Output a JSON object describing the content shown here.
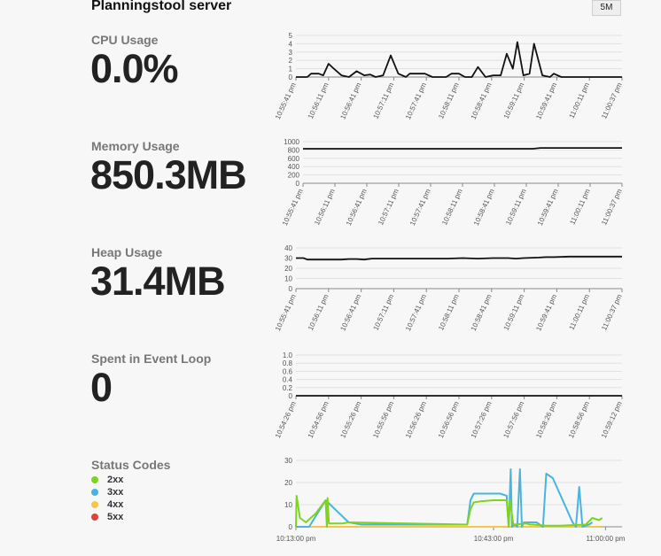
{
  "header": {
    "title": "Planningstool server",
    "range_button": "5M"
  },
  "metrics": {
    "cpu": {
      "label": "CPU Usage",
      "value": "0.0%"
    },
    "memory": {
      "label": "Memory Usage",
      "value": "850.3MB"
    },
    "heap": {
      "label": "Heap Usage",
      "value": "31.4MB"
    },
    "event_loop": {
      "label": "Spent in Event Loop",
      "value": "0"
    },
    "status": {
      "label": "Status Codes"
    }
  },
  "legend": [
    {
      "label": "2xx",
      "color": "#7ed321"
    },
    {
      "label": "3xx",
      "color": "#4ab4de"
    },
    {
      "label": "4xx",
      "color": "#f5c748"
    },
    {
      "label": "5xx",
      "color": "#d9453b"
    }
  ],
  "chart_data": [
    {
      "id": "cpu",
      "type": "line",
      "ylim": [
        0,
        5
      ],
      "yticks": [
        "0",
        "1",
        "2",
        "3",
        "4",
        "5"
      ],
      "xticks": [
        "10:55:41 pm",
        "10:56:11 pm",
        "10:56:41 pm",
        "10:57:11 pm",
        "10:57:41 pm",
        "10:58:11 pm",
        "10:58:41 pm",
        "10:59:11 pm",
        "10:59:41 pm",
        "11:00:11 pm",
        "11:00:37 pm"
      ],
      "series": [
        {
          "color": "#111111",
          "x": [
            0,
            1.5,
            2,
            3,
            3.6,
            4.3,
            5,
            6,
            7,
            8,
            9,
            9.8,
            10.5,
            11.5,
            12.5,
            13.5,
            14.5,
            15,
            16,
            17,
            18,
            19,
            19.8,
            20.5,
            21.5,
            22.3,
            23.2,
            24,
            25,
            26,
            27,
            27.8,
            28.6,
            29.2,
            30,
            30.8,
            31.4,
            32.5,
            33.5,
            34,
            35,
            36,
            37,
            38,
            39,
            40,
            41,
            42,
            43
          ],
          "y": [
            0,
            0,
            0.4,
            0.4,
            0.2,
            1.6,
            1.0,
            0.2,
            0,
            0.7,
            0.2,
            0.3,
            0,
            0.2,
            2.6,
            0.4,
            0,
            0.4,
            0.4,
            0.4,
            0,
            0,
            0,
            0.4,
            0.4,
            0,
            0,
            1.2,
            0,
            0.2,
            0.2,
            2.8,
            1.0,
            4.2,
            0.2,
            0.4,
            4.0,
            0.2,
            0,
            0.4,
            0,
            0,
            0,
            0,
            0,
            0,
            0,
            0,
            0
          ]
        }
      ]
    },
    {
      "id": "memory",
      "type": "line",
      "ylim": [
        0,
        1000
      ],
      "yticks": [
        "0",
        "200",
        "400",
        "600",
        "800",
        "1000"
      ],
      "xticks": [
        "10:55:41 pm",
        "10:56:11 pm",
        "10:56:41 pm",
        "10:57:11 pm",
        "10:57:41 pm",
        "10:58:11 pm",
        "10:58:41 pm",
        "10:59:11 pm",
        "10:59:41 pm",
        "11:00:11 pm",
        "11:00:37 pm"
      ],
      "series": [
        {
          "color": "#111111",
          "x": [
            0,
            10,
            20,
            30,
            31,
            32,
            40,
            43
          ],
          "y": [
            830,
            830,
            830,
            830,
            830,
            850,
            850,
            850
          ]
        }
      ]
    },
    {
      "id": "heap",
      "type": "line",
      "ylim": [
        0,
        40
      ],
      "yticks": [
        "0",
        "10",
        "20",
        "30",
        "40"
      ],
      "xticks": [
        "10:55:41 pm",
        "10:56:11 pm",
        "10:56:41 pm",
        "10:57:11 pm",
        "10:57:41 pm",
        "10:58:11 pm",
        "10:58:41 pm",
        "10:59:11 pm",
        "10:59:41 pm",
        "11:00:11 pm",
        "11:00:37 pm"
      ],
      "series": [
        {
          "color": "#111111",
          "x": [
            0,
            1,
            1.5,
            3,
            6,
            7,
            8,
            9,
            10,
            12,
            14,
            16,
            18,
            20,
            22,
            24,
            26,
            28,
            29,
            30,
            32,
            33,
            34,
            36,
            38,
            40,
            43
          ],
          "y": [
            30,
            30,
            28.5,
            28.5,
            28.5,
            29,
            29,
            28.5,
            29.5,
            29.5,
            29.5,
            29.5,
            29.5,
            29.5,
            30,
            29.5,
            30,
            30,
            29.5,
            30,
            30.5,
            31,
            31,
            31.5,
            31.5,
            31.5,
            31.5
          ]
        }
      ]
    },
    {
      "id": "event_loop",
      "type": "line",
      "ylim": [
        0,
        1.0
      ],
      "yticks": [
        "0",
        "0.2",
        "0.4",
        "0.6",
        "0.8",
        "1.0"
      ],
      "xticks": [
        "10:54:26 pm",
        "10:54:56 pm",
        "10:55:26 pm",
        "10:55:56 pm",
        "10:56:26 pm",
        "10:56:56 pm",
        "10:57:26 pm",
        "10:57:56 pm",
        "10:58:26 pm",
        "10:58:56 pm",
        "10:59:12 pm"
      ],
      "series": [
        {
          "color": "#111111",
          "x": [
            0,
            43
          ],
          "y": [
            0,
            0
          ]
        }
      ]
    },
    {
      "id": "status",
      "type": "line",
      "ylim": [
        0,
        30
      ],
      "yticks": [
        "0",
        "10",
        "20",
        "30"
      ],
      "xticks": [
        "10:13:00 pm",
        "10:43:00 pm",
        "11:00:00 pm"
      ],
      "xtick_pos": [
        0,
        30,
        47
      ],
      "xlim": [
        0,
        49.5
      ],
      "series": [
        {
          "name": "2xx",
          "color": "#7ed321",
          "x": [
            0,
            0.1,
            0.6,
            1.5,
            3,
            4.5,
            4.7,
            4.8,
            5,
            7,
            8,
            26,
            26.5,
            27,
            28,
            30,
            32,
            32.3,
            32.5,
            33,
            35,
            35.5,
            36,
            38,
            40,
            44,
            45,
            46,
            46.5
          ],
          "y": [
            0,
            14,
            4,
            2,
            6,
            12,
            0,
            13,
            1.5,
            1.5,
            2,
            1,
            8,
            11,
            11.5,
            12,
            12,
            0,
            12,
            1,
            1.5,
            1,
            1,
            0.5,
            0.5,
            1,
            4,
            3,
            4
          ]
        },
        {
          "name": "3xx",
          "color": "#4ab4de",
          "x": [
            0,
            2,
            4.5,
            8,
            10,
            26,
            26.5,
            27,
            31,
            32,
            32.3,
            32.6,
            32.8,
            33.2,
            33.6,
            34,
            34.3,
            34.6,
            35,
            36.5,
            37.5,
            38,
            39,
            42,
            42.5,
            43,
            43.5,
            44.5,
            45
          ],
          "y": [
            0,
            0,
            12,
            2,
            1,
            1,
            12,
            15,
            15,
            14,
            0,
            26,
            0,
            1,
            0,
            26,
            0,
            2,
            2,
            2,
            0,
            24,
            22,
            2,
            0,
            18,
            0,
            1,
            2
          ]
        },
        {
          "name": "4xx",
          "color": "#f5c748",
          "x": [
            0,
            46.5
          ],
          "y": [
            0,
            0
          ]
        },
        {
          "name": "5xx",
          "color": "#d9453b",
          "x": [
            0,
            46.5
          ],
          "y": [
            0,
            0
          ]
        }
      ]
    }
  ]
}
